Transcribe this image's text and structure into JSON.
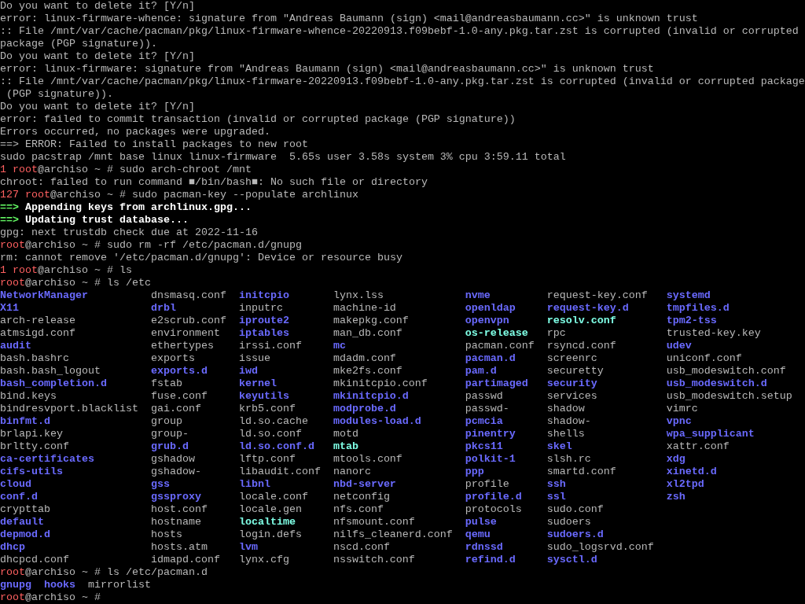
{
  "terminal": {
    "lines_before": [
      [
        {
          "text": "Do you want to delete it? [Y/n]",
          "kind": "text"
        }
      ],
      [
        {
          "text": "error: linux-firmware-whence: signature from \"Andreas Baumann (sign) <mail@andreasbaumann.cc>\" is unknown trust",
          "kind": "text"
        }
      ],
      [
        {
          "text": ":: File /mnt/var/cache/pacman/pkg/linux-firmware-whence-20220913.f09bebf-1.0-any.pkg.tar.zst is corrupted (invalid or corrupted",
          "kind": "text"
        }
      ],
      [
        {
          "text": "package (PGP signature)).",
          "kind": "text"
        }
      ],
      [
        {
          "text": "Do you want to delete it? [Y/n]",
          "kind": "text"
        }
      ],
      [
        {
          "text": "error: linux-firmware: signature from \"Andreas Baumann (sign) <mail@andreasbaumann.cc>\" is unknown trust",
          "kind": "text"
        }
      ],
      [
        {
          "text": ":: File /mnt/var/cache/pacman/pkg/linux-firmware-20220913.f09bebf-1.0-any.pkg.tar.zst is corrupted (invalid or corrupted package",
          "kind": "text"
        }
      ],
      [
        {
          "text": " (PGP signature)).",
          "kind": "text"
        }
      ],
      [
        {
          "text": "Do you want to delete it? [Y/n]",
          "kind": "text"
        }
      ],
      [
        {
          "text": "error: failed to commit transaction (invalid or corrupted package (PGP signature))",
          "kind": "text"
        }
      ],
      [
        {
          "text": "Errors occurred, no packages were upgraded.",
          "kind": "text"
        }
      ],
      [
        {
          "text": "==> ERROR: Failed to install packages to new root",
          "kind": "text"
        }
      ],
      [
        {
          "text": "sudo pacstrap /mnt base linux linux-firmware  5.65s user 3.58s system 3% cpu 3:59.11 total",
          "kind": "text"
        }
      ],
      [
        {
          "text": "1 ",
          "kind": "status"
        },
        {
          "text": "root",
          "kind": "user"
        },
        {
          "text": "@archiso ~ # sudo arch-chroot /mnt",
          "kind": "text"
        }
      ],
      [
        {
          "text": "chroot: failed to run command ■/bin/bash■: No such file or directory",
          "kind": "text"
        }
      ],
      [
        {
          "text": "127 ",
          "kind": "status"
        },
        {
          "text": "root",
          "kind": "user"
        },
        {
          "text": "@archiso ~ # sudo pacman-key --populate archlinux",
          "kind": "text"
        }
      ],
      [
        {
          "text": "==> ",
          "kind": "arrow"
        },
        {
          "text": "Appending keys from archlinux.gpg...",
          "kind": "bold"
        }
      ],
      [
        {
          "text": "==> ",
          "kind": "arrow"
        },
        {
          "text": "Updating trust database...",
          "kind": "bold"
        }
      ],
      [
        {
          "text": "gpg: next trustdb check due at 2022-11-16",
          "kind": "text"
        }
      ],
      [
        {
          "text": "root",
          "kind": "user"
        },
        {
          "text": "@archiso ~ # sudo rm -rf /etc/pacman.d/gnupg",
          "kind": "text"
        }
      ],
      [
        {
          "text": "rm: cannot remove '/etc/pacman.d/gnupg': Device or resource busy",
          "kind": "text"
        }
      ],
      [
        {
          "text": "1 ",
          "kind": "status"
        },
        {
          "text": "root",
          "kind": "user"
        },
        {
          "text": "@archiso ~ # ls",
          "kind": "text"
        }
      ],
      [
        {
          "text": "root",
          "kind": "user"
        },
        {
          "text": "@archiso ~ # ls /etc",
          "kind": "text"
        }
      ]
    ],
    "etc_listing": {
      "columns": [
        [
          {
            "name": "NetworkManager",
            "kind": "dir"
          },
          {
            "name": "X11",
            "kind": "dir"
          },
          {
            "name": "arch-release",
            "kind": "file"
          },
          {
            "name": "atmsigd.conf",
            "kind": "file"
          },
          {
            "name": "audit",
            "kind": "dir"
          },
          {
            "name": "bash.bashrc",
            "kind": "file"
          },
          {
            "name": "bash.bash_logout",
            "kind": "file"
          },
          {
            "name": "bash_completion.d",
            "kind": "dir"
          },
          {
            "name": "bind.keys",
            "kind": "file"
          },
          {
            "name": "bindresvport.blacklist",
            "kind": "file"
          },
          {
            "name": "binfmt.d",
            "kind": "dir"
          },
          {
            "name": "brlapi.key",
            "kind": "file"
          },
          {
            "name": "brltty.conf",
            "kind": "file"
          },
          {
            "name": "ca-certificates",
            "kind": "dir"
          },
          {
            "name": "cifs-utils",
            "kind": "dir"
          },
          {
            "name": "cloud",
            "kind": "dir"
          },
          {
            "name": "conf.d",
            "kind": "dir"
          },
          {
            "name": "crypttab",
            "kind": "file"
          },
          {
            "name": "default",
            "kind": "dir"
          },
          {
            "name": "depmod.d",
            "kind": "dir"
          },
          {
            "name": "dhcp",
            "kind": "dir"
          },
          {
            "name": "dhcpcd.conf",
            "kind": "file"
          }
        ],
        [
          {
            "name": "dnsmasq.conf",
            "kind": "file"
          },
          {
            "name": "drbl",
            "kind": "dir"
          },
          {
            "name": "e2scrub.conf",
            "kind": "file"
          },
          {
            "name": "environment",
            "kind": "file"
          },
          {
            "name": "ethertypes",
            "kind": "file"
          },
          {
            "name": "exports",
            "kind": "file"
          },
          {
            "name": "exports.d",
            "kind": "dir"
          },
          {
            "name": "fstab",
            "kind": "file"
          },
          {
            "name": "fuse.conf",
            "kind": "file"
          },
          {
            "name": "gai.conf",
            "kind": "file"
          },
          {
            "name": "group",
            "kind": "file"
          },
          {
            "name": "group-",
            "kind": "file"
          },
          {
            "name": "grub.d",
            "kind": "dir"
          },
          {
            "name": "gshadow",
            "kind": "file"
          },
          {
            "name": "gshadow-",
            "kind": "file"
          },
          {
            "name": "gss",
            "kind": "dir"
          },
          {
            "name": "gssproxy",
            "kind": "dir"
          },
          {
            "name": "host.conf",
            "kind": "file"
          },
          {
            "name": "hostname",
            "kind": "file"
          },
          {
            "name": "hosts",
            "kind": "file"
          },
          {
            "name": "hosts.atm",
            "kind": "file"
          },
          {
            "name": "idmapd.conf",
            "kind": "file"
          }
        ],
        [
          {
            "name": "initcpio",
            "kind": "dir"
          },
          {
            "name": "inputrc",
            "kind": "file"
          },
          {
            "name": "iproute2",
            "kind": "dir"
          },
          {
            "name": "iptables",
            "kind": "dir"
          },
          {
            "name": "irssi.conf",
            "kind": "file"
          },
          {
            "name": "issue",
            "kind": "file"
          },
          {
            "name": "iwd",
            "kind": "dir"
          },
          {
            "name": "kernel",
            "kind": "dir"
          },
          {
            "name": "keyutils",
            "kind": "dir"
          },
          {
            "name": "krb5.conf",
            "kind": "file"
          },
          {
            "name": "ld.so.cache",
            "kind": "file"
          },
          {
            "name": "ld.so.conf",
            "kind": "file"
          },
          {
            "name": "ld.so.conf.d",
            "kind": "dir"
          },
          {
            "name": "lftp.conf",
            "kind": "file"
          },
          {
            "name": "libaudit.conf",
            "kind": "file"
          },
          {
            "name": "libnl",
            "kind": "dir"
          },
          {
            "name": "locale.conf",
            "kind": "file"
          },
          {
            "name": "locale.gen",
            "kind": "file"
          },
          {
            "name": "localtime",
            "kind": "link"
          },
          {
            "name": "login.defs",
            "kind": "file"
          },
          {
            "name": "lvm",
            "kind": "dir"
          },
          {
            "name": "lynx.cfg",
            "kind": "file"
          }
        ],
        [
          {
            "name": "lynx.lss",
            "kind": "file"
          },
          {
            "name": "machine-id",
            "kind": "file"
          },
          {
            "name": "makepkg.conf",
            "kind": "file"
          },
          {
            "name": "man_db.conf",
            "kind": "file"
          },
          {
            "name": "mc",
            "kind": "dir"
          },
          {
            "name": "mdadm.conf",
            "kind": "file"
          },
          {
            "name": "mke2fs.conf",
            "kind": "file"
          },
          {
            "name": "mkinitcpio.conf",
            "kind": "file"
          },
          {
            "name": "mkinitcpio.d",
            "kind": "dir"
          },
          {
            "name": "modprobe.d",
            "kind": "dir"
          },
          {
            "name": "modules-load.d",
            "kind": "dir"
          },
          {
            "name": "motd",
            "kind": "file"
          },
          {
            "name": "mtab",
            "kind": "link"
          },
          {
            "name": "mtools.conf",
            "kind": "file"
          },
          {
            "name": "nanorc",
            "kind": "file"
          },
          {
            "name": "nbd-server",
            "kind": "dir"
          },
          {
            "name": "netconfig",
            "kind": "file"
          },
          {
            "name": "nfs.conf",
            "kind": "file"
          },
          {
            "name": "nfsmount.conf",
            "kind": "file"
          },
          {
            "name": "nilfs_cleanerd.conf",
            "kind": "file"
          },
          {
            "name": "nscd.conf",
            "kind": "file"
          },
          {
            "name": "nsswitch.conf",
            "kind": "file"
          }
        ],
        [
          {
            "name": "nvme",
            "kind": "dir"
          },
          {
            "name": "openldap",
            "kind": "dir"
          },
          {
            "name": "openvpn",
            "kind": "dir"
          },
          {
            "name": "os-release",
            "kind": "link"
          },
          {
            "name": "pacman.conf",
            "kind": "file"
          },
          {
            "name": "pacman.d",
            "kind": "dir"
          },
          {
            "name": "pam.d",
            "kind": "dir"
          },
          {
            "name": "partimaged",
            "kind": "dir"
          },
          {
            "name": "passwd",
            "kind": "file"
          },
          {
            "name": "passwd-",
            "kind": "file"
          },
          {
            "name": "pcmcia",
            "kind": "dir"
          },
          {
            "name": "pinentry",
            "kind": "dir"
          },
          {
            "name": "pkcs11",
            "kind": "dir"
          },
          {
            "name": "polkit-1",
            "kind": "dir"
          },
          {
            "name": "ppp",
            "kind": "dir"
          },
          {
            "name": "profile",
            "kind": "file"
          },
          {
            "name": "profile.d",
            "kind": "dir"
          },
          {
            "name": "protocols",
            "kind": "file"
          },
          {
            "name": "pulse",
            "kind": "dir"
          },
          {
            "name": "qemu",
            "kind": "dir"
          },
          {
            "name": "rdnssd",
            "kind": "dir"
          },
          {
            "name": "refind.d",
            "kind": "dir"
          }
        ],
        [
          {
            "name": "request-key.conf",
            "kind": "file"
          },
          {
            "name": "request-key.d",
            "kind": "dir"
          },
          {
            "name": "resolv.conf",
            "kind": "link"
          },
          {
            "name": "rpc",
            "kind": "file"
          },
          {
            "name": "rsyncd.conf",
            "kind": "file"
          },
          {
            "name": "screenrc",
            "kind": "file"
          },
          {
            "name": "securetty",
            "kind": "file"
          },
          {
            "name": "security",
            "kind": "dir"
          },
          {
            "name": "services",
            "kind": "file"
          },
          {
            "name": "shadow",
            "kind": "file"
          },
          {
            "name": "shadow-",
            "kind": "file"
          },
          {
            "name": "shells",
            "kind": "file"
          },
          {
            "name": "skel",
            "kind": "dir"
          },
          {
            "name": "slsh.rc",
            "kind": "file"
          },
          {
            "name": "smartd.conf",
            "kind": "file"
          },
          {
            "name": "ssh",
            "kind": "dir"
          },
          {
            "name": "ssl",
            "kind": "dir"
          },
          {
            "name": "sudo.conf",
            "kind": "file"
          },
          {
            "name": "sudoers",
            "kind": "file"
          },
          {
            "name": "sudoers.d",
            "kind": "dir"
          },
          {
            "name": "sudo_logsrvd.conf",
            "kind": "file"
          },
          {
            "name": "sysctl.d",
            "kind": "dir"
          }
        ],
        [
          {
            "name": "systemd",
            "kind": "dir"
          },
          {
            "name": "tmpfiles.d",
            "kind": "dir"
          },
          {
            "name": "tpm2-tss",
            "kind": "dir"
          },
          {
            "name": "trusted-key.key",
            "kind": "file"
          },
          {
            "name": "udev",
            "kind": "dir"
          },
          {
            "name": "uniconf.conf",
            "kind": "file"
          },
          {
            "name": "usb_modeswitch.conf",
            "kind": "file"
          },
          {
            "name": "usb_modeswitch.d",
            "kind": "dir"
          },
          {
            "name": "usb_modeswitch.setup",
            "kind": "file"
          },
          {
            "name": "vimrc",
            "kind": "file"
          },
          {
            "name": "vpnc",
            "kind": "dir"
          },
          {
            "name": "wpa_supplicant",
            "kind": "dir"
          },
          {
            "name": "xattr.conf",
            "kind": "file"
          },
          {
            "name": "xdg",
            "kind": "dir"
          },
          {
            "name": "xinetd.d",
            "kind": "dir"
          },
          {
            "name": "xl2tpd",
            "kind": "dir"
          },
          {
            "name": "zsh",
            "kind": "dir"
          }
        ]
      ]
    },
    "lines_after": [
      [
        {
          "text": "root",
          "kind": "user"
        },
        {
          "text": "@archiso ~ # ls /etc/pacman.d",
          "kind": "text"
        }
      ],
      [
        {
          "text": "gnupg  ",
          "kind": "dir"
        },
        {
          "text": "hooks",
          "kind": "dir"
        },
        {
          "text": "  mirrorlist",
          "kind": "text"
        }
      ],
      [
        {
          "text": "root",
          "kind": "user"
        },
        {
          "text": "@archiso ~ #",
          "kind": "text"
        }
      ]
    ]
  }
}
